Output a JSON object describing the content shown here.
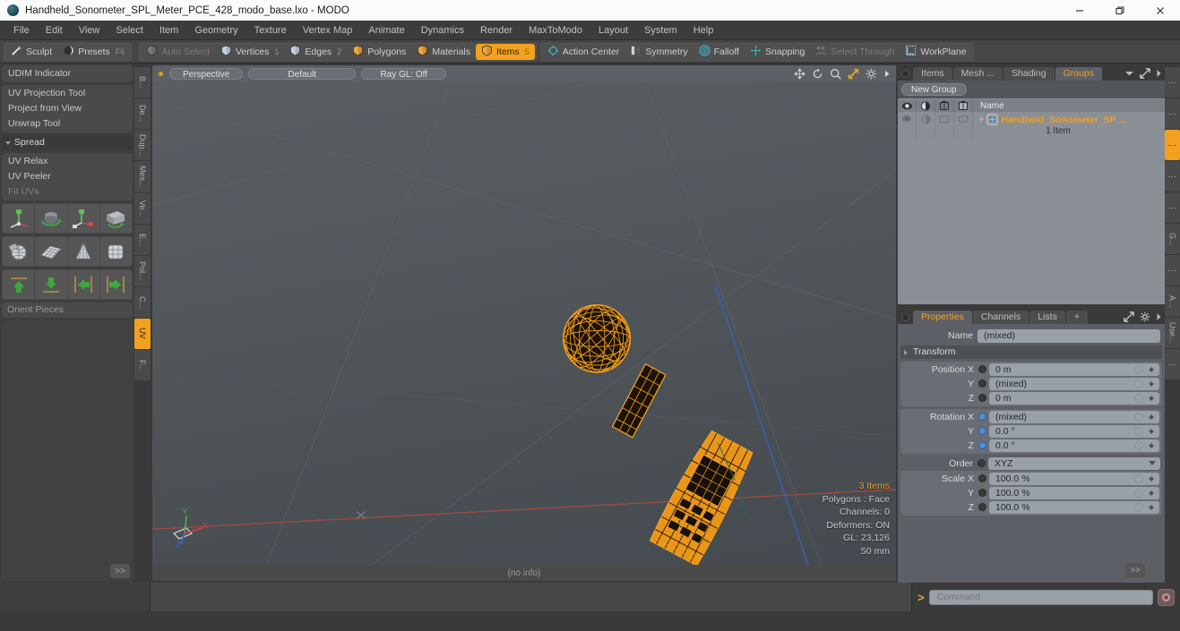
{
  "window": {
    "title": "Handheld_Sonometer_SPL_Meter_PCE_428_modo_base.lxo - MODO",
    "minimize": "–",
    "maximize": "❐",
    "close": "✕"
  },
  "menubar": {
    "items": [
      "File",
      "Edit",
      "View",
      "Select",
      "Item",
      "Geometry",
      "Texture",
      "Vertex Map",
      "Animate",
      "Dynamics",
      "Render",
      "MaxToModo",
      "Layout",
      "System",
      "Help"
    ]
  },
  "toolbar": {
    "group1": [
      {
        "label": "Sculpt",
        "icon": "brush-icon",
        "state": "normal",
        "num": ""
      },
      {
        "label": "Presets",
        "icon": "sphere-icon",
        "state": "normal",
        "num": "F6"
      }
    ],
    "group2": [
      {
        "label": "Auto Select",
        "icon": "shield-icon",
        "state": "disabled",
        "num": ""
      },
      {
        "label": "Vertices",
        "icon": "shield-icon",
        "state": "normal",
        "num": "1"
      },
      {
        "label": "Edges",
        "icon": "shield-icon",
        "state": "normal",
        "num": "2"
      },
      {
        "label": "Polygons",
        "icon": "shield-icon",
        "state": "normal",
        "num": ""
      },
      {
        "label": "Materials",
        "icon": "shield-icon",
        "state": "normal",
        "num": ""
      },
      {
        "label": "Items",
        "icon": "shield-icon",
        "state": "active",
        "num": "5"
      }
    ],
    "group3": [
      {
        "label": "Action Center",
        "icon": "crosshair-icon",
        "state": "normal",
        "num": ""
      },
      {
        "label": "Symmetry",
        "icon": "mirror-icon",
        "state": "normal",
        "num": ""
      },
      {
        "label": "Falloff",
        "icon": "target-icon",
        "state": "normal",
        "num": ""
      },
      {
        "label": "Snapping",
        "icon": "snap-icon",
        "state": "normal",
        "num": ""
      },
      {
        "label": "Select Through",
        "icon": "select-through-icon",
        "state": "disabled",
        "num": ""
      },
      {
        "label": "WorkPlane",
        "icon": "workplane-icon",
        "state": "normal",
        "num": ""
      }
    ]
  },
  "left_panel": {
    "udim": "UDIM Indicator",
    "uv_tools": [
      "UV Projection Tool",
      "Project from View",
      "Unwrap Tool"
    ],
    "spread_header": "Spread",
    "uv_tools2": [
      {
        "label": "UV Relax",
        "dim": false
      },
      {
        "label": "UV Peeler",
        "dim": false
      },
      {
        "label": "Fit UVs",
        "dim": true
      }
    ],
    "icon_rows": [
      [
        "move-uv-icon",
        "rotate-uv-icon",
        "scale-uv-icon",
        "flip-uv-icon"
      ],
      [
        "sphere-wrap-icon",
        "grid-plane-icon",
        "cone-uv-icon",
        "cube-uv-icon"
      ],
      [
        "align-top-icon",
        "align-bottom-icon",
        "align-left-icon",
        "align-right-icon"
      ]
    ],
    "orient_field": "Orient Pieces",
    "more": ">>",
    "vtabs": [
      {
        "label": "B...",
        "active": false
      },
      {
        "label": "De...",
        "active": false
      },
      {
        "label": "Dup...",
        "active": false
      },
      {
        "label": "Mes...",
        "active": false
      },
      {
        "label": "Ve...",
        "active": false
      },
      {
        "label": "E...",
        "active": false
      },
      {
        "label": "Pol...",
        "active": false
      },
      {
        "label": "C...",
        "active": false
      },
      {
        "label": "UV",
        "active": true
      },
      {
        "label": "F...",
        "active": false
      }
    ]
  },
  "viewport": {
    "pills": [
      "Perspective",
      "Default",
      "Ray GL: Off"
    ],
    "tools": [
      "pan-icon",
      "rotate-icon",
      "zoom-icon",
      "fit-icon",
      "gear-icon",
      "chevron-right-icon"
    ],
    "stats": [
      {
        "text": "3 Items",
        "highlight": true
      },
      {
        "text": "Polygons : Face",
        "highlight": false
      },
      {
        "text": "Channels: 0",
        "highlight": false
      },
      {
        "text": "Deformers: ON",
        "highlight": false
      },
      {
        "text": "GL: 23,126",
        "highlight": false
      },
      {
        "text": "50 mm",
        "highlight": false
      }
    ],
    "footer": "(no info)",
    "axis_labels": {
      "x": "X",
      "y": "Y",
      "z": "Z"
    }
  },
  "right_panel": {
    "top_tabs": [
      {
        "label": "Items",
        "active": false
      },
      {
        "label": "Mesh ...",
        "active": false
      },
      {
        "label": "Shading",
        "active": false
      },
      {
        "label": "Groups",
        "active": true
      }
    ],
    "new_group_button": "New Group",
    "tree_columns": [
      "visibility-icon",
      "render-icon",
      "wireframe-icon",
      "shaded-icon",
      "Name"
    ],
    "tree_rows": [
      {
        "name": "Handheld_Sonometer_SP ...",
        "sub": "1 Item",
        "icon": "group-icon"
      }
    ],
    "bottom_tabs": [
      {
        "label": "Properties",
        "active": true
      },
      {
        "label": "Channels",
        "active": false
      },
      {
        "label": "Lists",
        "active": false
      },
      {
        "label": "+",
        "active": false
      }
    ],
    "properties": {
      "name_label": "Name",
      "name_value": "(mixed)",
      "transform_header": "Transform",
      "position": {
        "label": "Position X",
        "rows": [
          {
            "axis": "Position X",
            "value": "0 m",
            "blue": false
          },
          {
            "axis": "Y",
            "value": "(mixed)",
            "blue": false
          },
          {
            "axis": "Z",
            "value": "0 m",
            "blue": false
          }
        ]
      },
      "rotation": {
        "rows": [
          {
            "axis": "Rotation X",
            "value": "(mixed)",
            "blue": true
          },
          {
            "axis": "Y",
            "value": "0.0 °",
            "blue": true
          },
          {
            "axis": "Z",
            "value": "0.0 °",
            "blue": true
          }
        ]
      },
      "order": {
        "label": "Order",
        "value": "XYZ"
      },
      "scale": {
        "rows": [
          {
            "axis": "Scale X",
            "value": "100.0 %",
            "blue": false
          },
          {
            "axis": "Y",
            "value": "100.0 %",
            "blue": false
          },
          {
            "axis": "Z",
            "value": "100.0 %",
            "blue": false
          }
        ]
      },
      "more": ">>"
    },
    "vtabs": [
      {
        "label": "⋮",
        "active": false
      },
      {
        "label": "⋮",
        "active": false
      },
      {
        "label": "⋮",
        "active": true
      },
      {
        "label": "⋮",
        "active": false
      },
      {
        "label": "⋮",
        "active": false
      },
      {
        "label": "G...",
        "active": false
      },
      {
        "label": "⋮",
        "active": false
      },
      {
        "label": "A...",
        "active": false
      },
      {
        "label": "Use...",
        "active": false
      },
      {
        "label": "⋮",
        "active": false
      }
    ]
  },
  "command_bar": {
    "caret": ">",
    "placeholder": "Command",
    "record_icon": "record-icon"
  },
  "colors": {
    "accent": "#f2a01e",
    "wireframe": "#f2a01e",
    "panel_bg": "#5c6066",
    "app_bg": "#3a3a3a"
  }
}
